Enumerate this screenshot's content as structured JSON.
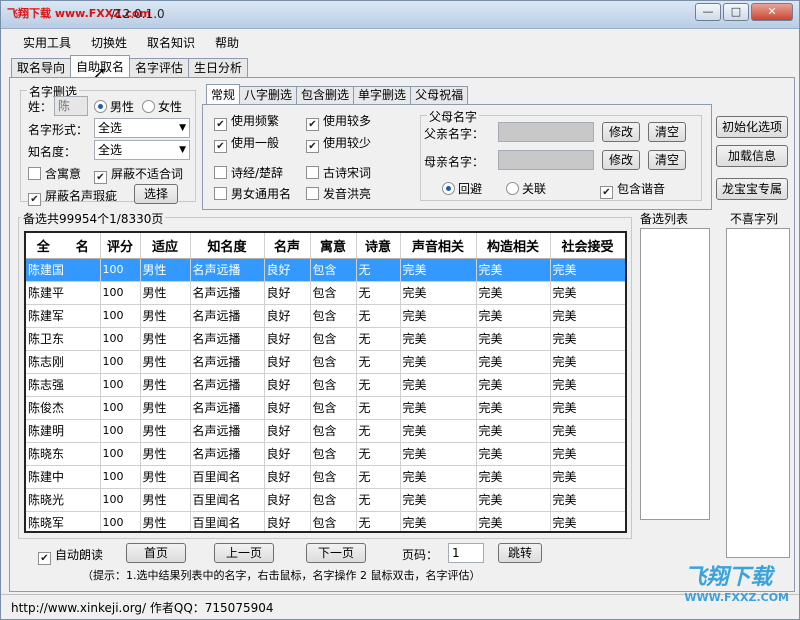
{
  "window": {
    "logo": "飞翔下载 www.FXXZ.com",
    "title": "/12.0.1.0",
    "minimize": "—",
    "restore": "□",
    "close": "✕"
  },
  "menu": [
    "实用工具",
    "切换姓",
    "取名知识",
    "帮助"
  ],
  "main_tabs": [
    "取名导向",
    "自助取名",
    "名字评估",
    "生日分析"
  ],
  "name_filter": {
    "title": "名字删选",
    "surname_label": "姓：",
    "surname_value": "陈",
    "male": "男性",
    "female": "女性",
    "form_label": "名字形式：",
    "form_value": "全选",
    "fame_label": "知名度：",
    "fame_value": "全选",
    "meaning_label": "含寓意",
    "block_bad": "屏蔽不适合词",
    "block_flaw": "屏蔽名声瑕疵",
    "select_btn": "选择"
  },
  "sub_tabs": [
    "常规",
    "八字删选",
    "包含删选",
    "单字删选",
    "父母祝福"
  ],
  "options": {
    "use_frequent": "使用频繁",
    "use_more": "使用较多",
    "use_normal": "使用一般",
    "use_less": "使用较少",
    "poetry": "诗经/楚辞",
    "tang_song": "古诗宋词",
    "unisex": "男女通用名",
    "loud": "发音洪亮"
  },
  "parents": {
    "title": "父母名字",
    "father_label": "父亲名字：",
    "mother_label": "母亲名字：",
    "edit": "修改",
    "clear": "清空",
    "avoid": "回避",
    "relate": "关联",
    "homophone": "包含谐音"
  },
  "right_buttons": [
    "初始化选项",
    "加载信息",
    "龙宝宝专属"
  ],
  "list_info": "备选共99954个1/8330页",
  "backup_title": "备选列表",
  "dislike_title": "不喜字列",
  "table": {
    "headers": [
      "全　　名",
      "评分",
      "适应",
      "知名度",
      "名声",
      "寓意",
      "诗意",
      "声音相关",
      "构造相关",
      "社会接受"
    ],
    "rows": [
      [
        "陈建国",
        "100",
        "男性",
        "名声远播",
        "良好",
        "包含",
        "无",
        "完美",
        "完美",
        "完美"
      ],
      [
        "陈建平",
        "100",
        "男性",
        "名声远播",
        "良好",
        "包含",
        "无",
        "完美",
        "完美",
        "完美"
      ],
      [
        "陈建军",
        "100",
        "男性",
        "名声远播",
        "良好",
        "包含",
        "无",
        "完美",
        "完美",
        "完美"
      ],
      [
        "陈卫东",
        "100",
        "男性",
        "名声远播",
        "良好",
        "包含",
        "无",
        "完美",
        "完美",
        "完美"
      ],
      [
        "陈志刚",
        "100",
        "男性",
        "名声远播",
        "良好",
        "包含",
        "无",
        "完美",
        "完美",
        "完美"
      ],
      [
        "陈志强",
        "100",
        "男性",
        "名声远播",
        "良好",
        "包含",
        "无",
        "完美",
        "完美",
        "完美"
      ],
      [
        "陈俊杰",
        "100",
        "男性",
        "名声远播",
        "良好",
        "包含",
        "无",
        "完美",
        "完美",
        "完美"
      ],
      [
        "陈建明",
        "100",
        "男性",
        "名声远播",
        "良好",
        "包含",
        "无",
        "完美",
        "完美",
        "完美"
      ],
      [
        "陈晓东",
        "100",
        "男性",
        "名声远播",
        "良好",
        "包含",
        "无",
        "完美",
        "完美",
        "完美"
      ],
      [
        "陈建中",
        "100",
        "男性",
        "百里闻名",
        "良好",
        "包含",
        "无",
        "完美",
        "完美",
        "完美"
      ],
      [
        "陈晓光",
        "100",
        "男性",
        "百里闻名",
        "良好",
        "包含",
        "无",
        "完美",
        "完美",
        "完美"
      ],
      [
        "陈晓军",
        "100",
        "男性",
        "百里闻名",
        "良好",
        "包含",
        "无",
        "完美",
        "完美",
        "完美"
      ]
    ]
  },
  "pager": {
    "auto_read": "自动朗读",
    "first": "首页",
    "prev": "上一页",
    "next": "下一页",
    "page_label": "页码：",
    "page_value": "1",
    "jump": "跳转"
  },
  "hint": "（提示：1.选中结果列表中的名字，右击鼠标，名字操作 2 鼠标双击，名字评估）",
  "status": "http://www.xinkeji.org/ 作者QQ：715075904",
  "watermark": {
    "main": "飞翔下载",
    "sub": "WWW.FXXZ.COM"
  }
}
